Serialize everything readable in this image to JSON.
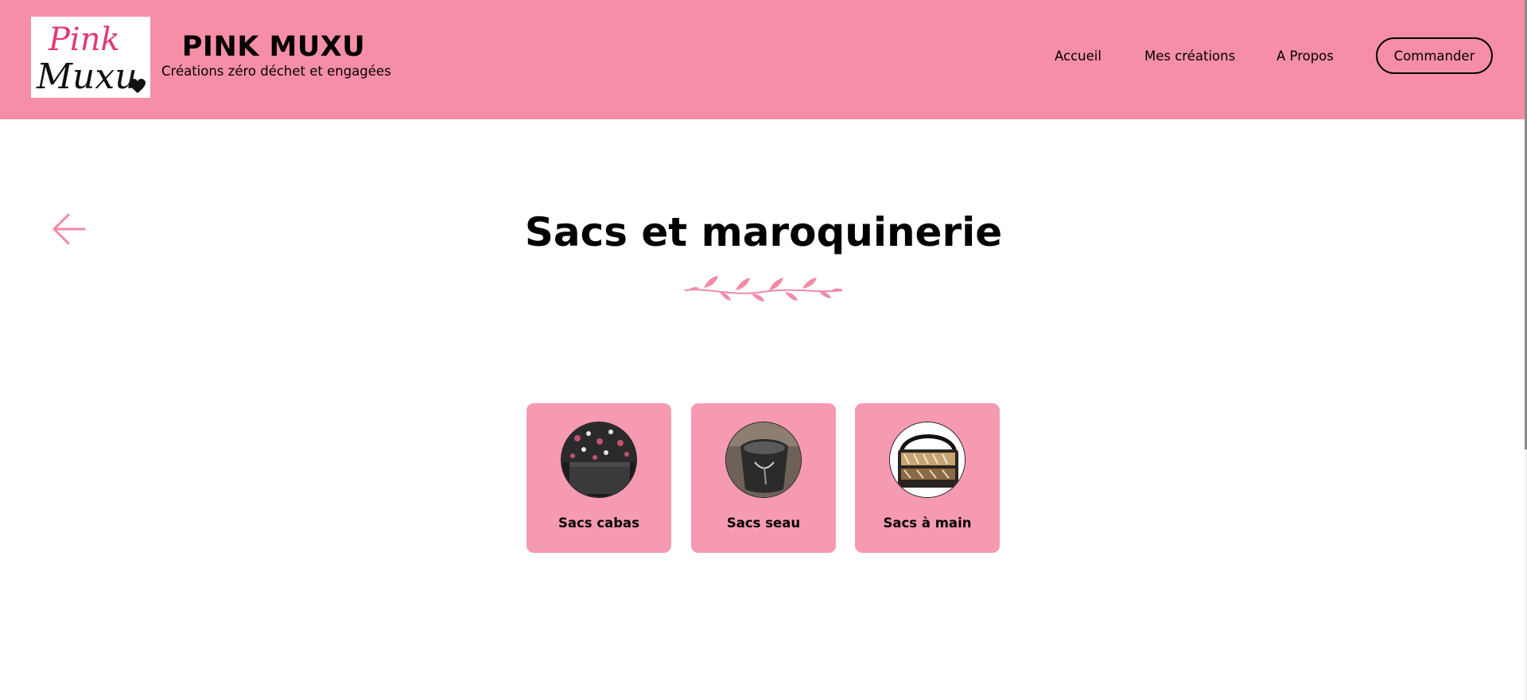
{
  "header": {
    "logo_line1": "Pink",
    "logo_line2": "Muxu",
    "brand_title": "PINK MUXU",
    "tagline": "Créations zéro déchet et engagées",
    "nav": [
      {
        "label": "Accueil"
      },
      {
        "label": "Mes créations"
      },
      {
        "label": "A Propos"
      }
    ],
    "order_button": "Commander"
  },
  "main": {
    "title": "Sacs et maroquinerie",
    "categories": [
      {
        "label": "Sacs cabas"
      },
      {
        "label": "Sacs seau"
      },
      {
        "label": "Sacs à main"
      }
    ]
  },
  "colors": {
    "header_bg": "#f78ea8",
    "card_bg": "#f59ab1",
    "accent_pink": "#f08aa6",
    "logo_pink": "#e0397a"
  },
  "icons": {
    "back": "arrow-left-icon",
    "divider": "leaf-branch-icon"
  }
}
